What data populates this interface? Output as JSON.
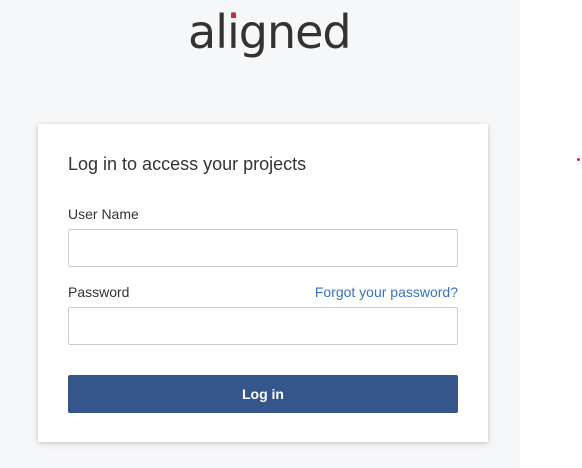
{
  "brand": {
    "logo_text_before": "al",
    "logo_text_i": "i",
    "logo_text_after": "gned",
    "accent_color": "#d62828"
  },
  "login": {
    "title": "Log in to access your projects",
    "username_label": "User Name",
    "username_value": "",
    "password_label": "Password",
    "password_value": "",
    "forgot_link": "Forgot your password?",
    "submit_label": "Log in",
    "button_color": "#34568b",
    "link_color": "#3b73b9"
  }
}
